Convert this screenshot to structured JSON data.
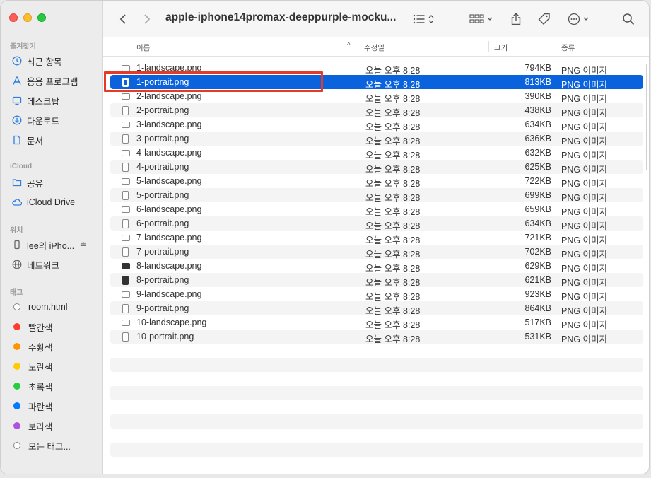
{
  "window": {
    "title": "apple-iphone14promax-deeppurple-mocku..."
  },
  "sidebar": {
    "favorites_label": "즐겨찾기",
    "favorites": [
      {
        "label": "최근 항목",
        "icon": "clock-icon"
      },
      {
        "label": "응용 프로그램",
        "icon": "applications-icon"
      },
      {
        "label": "데스크탑",
        "icon": "desktop-icon"
      },
      {
        "label": "다운로드",
        "icon": "download-icon"
      },
      {
        "label": "문서",
        "icon": "document-icon"
      }
    ],
    "icloud_label": "iCloud",
    "icloud": [
      {
        "label": "공유",
        "icon": "shared-folder-icon"
      },
      {
        "label": "iCloud Drive",
        "icon": "cloud-icon"
      }
    ],
    "locations_label": "위치",
    "locations": [
      {
        "label": "lee의 iPho...",
        "icon": "iphone-icon"
      },
      {
        "label": "네트워크",
        "icon": "network-icon"
      }
    ],
    "tags_label": "태그",
    "tags": [
      {
        "label": "room.html",
        "color": "#ffffff"
      },
      {
        "label": "빨간색",
        "color": "#ff3b30"
      },
      {
        "label": "주황색",
        "color": "#ff9500"
      },
      {
        "label": "노란색",
        "color": "#ffcc00"
      },
      {
        "label": "초록색",
        "color": "#28cd41"
      },
      {
        "label": "파란색",
        "color": "#007aff"
      },
      {
        "label": "보라색",
        "color": "#af52de"
      },
      {
        "label": "모든 태그...",
        "color": "#cccccc"
      }
    ]
  },
  "columns": {
    "name": "이름",
    "date": "수정일",
    "size": "크기",
    "kind": "종류"
  },
  "files": [
    {
      "name": "1-landscape.png",
      "date": "오늘 오후 8:28",
      "size": "794KB",
      "kind": "PNG 이미지",
      "orientation": "landscape",
      "selected": false
    },
    {
      "name": "1-portrait.png",
      "date": "오늘 오후 8:28",
      "size": "813KB",
      "kind": "PNG 이미지",
      "orientation": "portrait",
      "selected": true
    },
    {
      "name": "2-landscape.png",
      "date": "오늘 오후 8:28",
      "size": "390KB",
      "kind": "PNG 이미지",
      "orientation": "landscape",
      "selected": false
    },
    {
      "name": "2-portrait.png",
      "date": "오늘 오후 8:28",
      "size": "438KB",
      "kind": "PNG 이미지",
      "orientation": "portrait",
      "selected": false
    },
    {
      "name": "3-landscape.png",
      "date": "오늘 오후 8:28",
      "size": "634KB",
      "kind": "PNG 이미지",
      "orientation": "landscape",
      "selected": false
    },
    {
      "name": "3-portrait.png",
      "date": "오늘 오후 8:28",
      "size": "636KB",
      "kind": "PNG 이미지",
      "orientation": "portrait",
      "selected": false
    },
    {
      "name": "4-landscape.png",
      "date": "오늘 오후 8:28",
      "size": "632KB",
      "kind": "PNG 이미지",
      "orientation": "landscape",
      "selected": false
    },
    {
      "name": "4-portrait.png",
      "date": "오늘 오후 8:28",
      "size": "625KB",
      "kind": "PNG 이미지",
      "orientation": "portrait",
      "selected": false
    },
    {
      "name": "5-landscape.png",
      "date": "오늘 오후 8:28",
      "size": "722KB",
      "kind": "PNG 이미지",
      "orientation": "landscape",
      "selected": false
    },
    {
      "name": "5-portrait.png",
      "date": "오늘 오후 8:28",
      "size": "699KB",
      "kind": "PNG 이미지",
      "orientation": "portrait",
      "selected": false
    },
    {
      "name": "6-landscape.png",
      "date": "오늘 오후 8:28",
      "size": "659KB",
      "kind": "PNG 이미지",
      "orientation": "landscape",
      "selected": false
    },
    {
      "name": "6-portrait.png",
      "date": "오늘 오후 8:28",
      "size": "634KB",
      "kind": "PNG 이미지",
      "orientation": "portrait",
      "selected": false
    },
    {
      "name": "7-landscape.png",
      "date": "오늘 오후 8:28",
      "size": "721KB",
      "kind": "PNG 이미지",
      "orientation": "landscape",
      "selected": false
    },
    {
      "name": "7-portrait.png",
      "date": "오늘 오후 8:28",
      "size": "702KB",
      "kind": "PNG 이미지",
      "orientation": "portrait",
      "selected": false
    },
    {
      "name": "8-landscape.png",
      "date": "오늘 오후 8:28",
      "size": "629KB",
      "kind": "PNG 이미지",
      "orientation": "landscape-dark",
      "selected": false
    },
    {
      "name": "8-portrait.png",
      "date": "오늘 오후 8:28",
      "size": "621KB",
      "kind": "PNG 이미지",
      "orientation": "portrait-dark",
      "selected": false
    },
    {
      "name": "9-landscape.png",
      "date": "오늘 오후 8:28",
      "size": "923KB",
      "kind": "PNG 이미지",
      "orientation": "landscape",
      "selected": false
    },
    {
      "name": "9-portrait.png",
      "date": "오늘 오후 8:28",
      "size": "864KB",
      "kind": "PNG 이미지",
      "orientation": "portrait",
      "selected": false
    },
    {
      "name": "10-landscape.png",
      "date": "오늘 오후 8:28",
      "size": "517KB",
      "kind": "PNG 이미지",
      "orientation": "landscape",
      "selected": false
    },
    {
      "name": "10-portrait.png",
      "date": "오늘 오후 8:28",
      "size": "531KB",
      "kind": "PNG 이미지",
      "orientation": "portrait",
      "selected": false
    }
  ],
  "colors": {
    "selection": "#0a63dc",
    "highlight_border": "#e53a28"
  }
}
